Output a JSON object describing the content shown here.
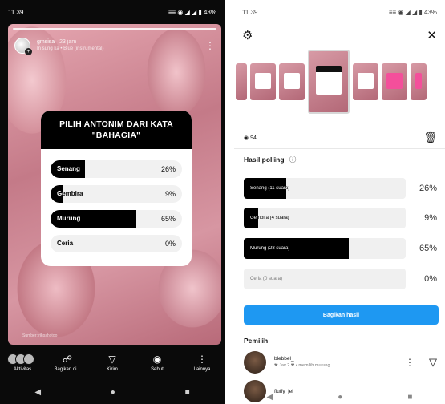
{
  "left": {
    "status": {
      "time": "11.39",
      "icons": "≡≡ ◉ ◢ ◢ ▮ 43%"
    },
    "story_user": {
      "name": "gmsisa",
      "time": "23 jam",
      "sub": "In sung ka • Blue (instrumental)"
    },
    "poll": {
      "question": "PILIH ANTONIM DARI KATA \"BAHAGIA\"",
      "options": [
        {
          "label": "Senang",
          "percent": "26%",
          "value": 0.26
        },
        {
          "label": "Gembira",
          "percent": "9%",
          "value": 0.09
        },
        {
          "label": "Murung",
          "percent": "65%",
          "value": 0.65
        },
        {
          "label": "Ceria",
          "percent": "0%",
          "value": 0.0
        }
      ]
    },
    "caption": "Sumber: rikoshotoo",
    "bottom_actions": [
      {
        "icon": "avatars",
        "label": "Aktivitas"
      },
      {
        "icon": "share",
        "label": "Bagikan di..."
      },
      {
        "icon": "send",
        "label": "Kirim"
      },
      {
        "icon": "mention",
        "label": "Sebut"
      },
      {
        "icon": "more",
        "label": "Lainnya"
      }
    ]
  },
  "right": {
    "status": {
      "time": "11.39",
      "icons": "≡≡ ◉ ◢ ◢ ▮ 43%"
    },
    "views": "94",
    "results_title": "Hasil polling",
    "results": [
      {
        "label": "Senang (11 suara)",
        "percent": "26%",
        "value": 0.26
      },
      {
        "label": "Gembira (4 suara)",
        "percent": "9%",
        "value": 0.09
      },
      {
        "label": "Murung (28 suara)",
        "percent": "65%",
        "value": 0.65
      },
      {
        "label": "Ceria (0 suara)",
        "percent": "0%",
        "value": 0.0
      }
    ],
    "share_label": "Bagikan hasil",
    "voters_title": "Pemilih",
    "voters": [
      {
        "name": "blebbel_",
        "sub": "❤ Jav 2 ❤ • memilih murung"
      },
      {
        "name": "fluffy_jel",
        "sub": ""
      }
    ]
  },
  "colors": {
    "accent": "#1e98f2",
    "bar_fill": "#000000",
    "bar_track": "#f0f0f0"
  }
}
